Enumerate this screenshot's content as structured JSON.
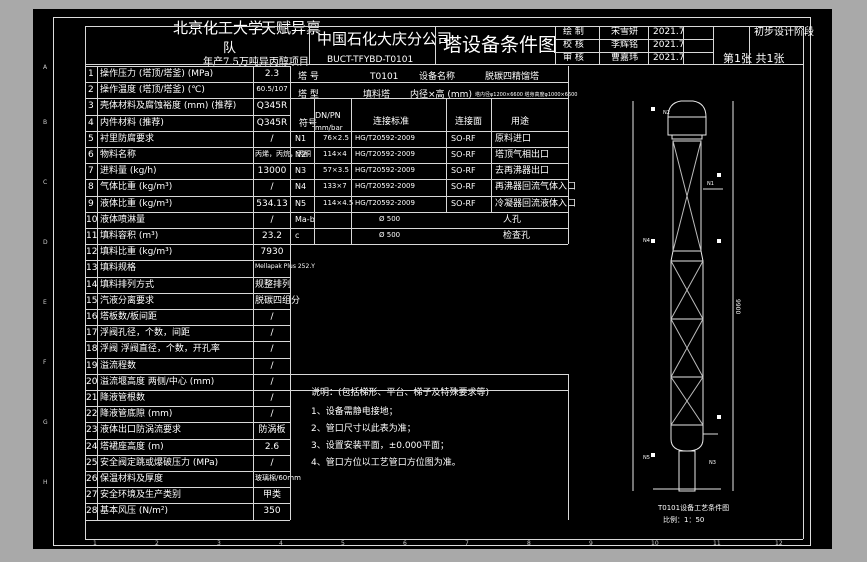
{
  "header": {
    "university": "北京化工大学",
    "team": "天赋异禀",
    "team2": "队",
    "project_line": "年产7.5万吨异丙醇项目",
    "company": "中国石化大庆分公司",
    "doc_no": "BUCT-TFYBD-T0101",
    "doc_title": "塔设备条件图",
    "sign_rows": [
      {
        "role": "绘 制",
        "name": "宋雪妍",
        "date": "2021.7"
      },
      {
        "role": "校 核",
        "name": "李辉铭",
        "date": "2021.7"
      },
      {
        "role": "审 核",
        "name": "曹嘉玮",
        "date": "2021.7"
      }
    ],
    "stage": "初步设计阶段",
    "sheet": "第1张  共1张"
  },
  "params": [
    {
      "no": "1",
      "name": "操作压力 (塔顶/塔釜) (MPa)",
      "value": "2.3"
    },
    {
      "no": "2",
      "name": "操作温度 (塔顶/塔釜) (℃)",
      "value": "60.5/107"
    },
    {
      "no": "3",
      "name": "壳体材料及腐蚀裕度 (mm) (推荐)",
      "value": "Q345R"
    },
    {
      "no": "4",
      "name": "内件材料 (推荐)",
      "value": "Q345R"
    },
    {
      "no": "5",
      "name": "衬里防腐要求",
      "value": "/"
    },
    {
      "no": "6",
      "name": "物料名称",
      "value": "丙烯，丙烷，丙酮"
    },
    {
      "no": "7",
      "name": "进料量 (kg/h)",
      "value": "13000"
    },
    {
      "no": "8",
      "name": "气体比重 (kg/m³)",
      "value": "/"
    },
    {
      "no": "9",
      "name": "液体比重 (kg/m³)",
      "value": "534.13"
    },
    {
      "no": "10",
      "name": "液体喷淋量",
      "value": "/"
    },
    {
      "no": "11",
      "name": "填料容积 (m³)",
      "value": "23.2"
    },
    {
      "no": "12",
      "name": "填料比重 (kg/m³)",
      "value": "7930"
    },
    {
      "no": "13",
      "name": "填料规格",
      "value": "Mellapak Plus 252.Y"
    },
    {
      "no": "14",
      "name": "填料排列方式",
      "value": "规整排列"
    },
    {
      "no": "15",
      "name": "汽液分离要求",
      "value": "脱碳四组分"
    },
    {
      "no": "16",
      "name": "塔板数/板间距",
      "value": "/"
    },
    {
      "no": "17",
      "name": "浮阀孔径，个数，间距",
      "value": "/"
    },
    {
      "no": "18",
      "name": "浮阀 浮阀直径，个数，开孔率",
      "value": "/"
    },
    {
      "no": "19",
      "name": "溢流程数",
      "value": "/"
    },
    {
      "no": "20",
      "name": "溢流堰高度 两侧/中心 (mm)",
      "value": "/"
    },
    {
      "no": "21",
      "name": "降液管根数",
      "value": "/"
    },
    {
      "no": "22",
      "name": "降液管底隙 (mm)",
      "value": "/"
    },
    {
      "no": "23",
      "name": "液体出口防涡流要求",
      "value": "防涡板"
    },
    {
      "no": "24",
      "name": "塔裙座高度 (m)",
      "value": "2.6"
    },
    {
      "no": "25",
      "name": "安全阀定跳或爆破压力 (MPa)",
      "value": "/"
    },
    {
      "no": "26",
      "name": "保温材料及厚度",
      "value": "玻璃棉/60mm"
    },
    {
      "no": "27",
      "name": "安全环境及生产类别",
      "value": "甲类"
    },
    {
      "no": "28",
      "name": "基本风压 (N/m²)",
      "value": "350"
    }
  ],
  "equipment": {
    "label_no": "塔 号",
    "no": "T0101",
    "label_name": "设备名称",
    "name": "脱碳四精馏塔",
    "label_type": "塔 型",
    "type": "填料塔",
    "label_dim": "内径×高 (mm)",
    "dim": "塔内径φ1200×6600  塔身高度φ1000×6600"
  },
  "nozzle_head": {
    "c1": "符号",
    "c2": "DN/PN",
    "c2b": "mm/bar",
    "c3": "连接标准",
    "c4": "连接面",
    "c5": "用途"
  },
  "nozzles": [
    {
      "sym": "N1",
      "dn": "76×2.5",
      "std": "HG/T20592-2009",
      "face": "SO-RF",
      "use": "原料进口"
    },
    {
      "sym": "N2",
      "dn": "114×4",
      "std": "HG/T20592-2009",
      "face": "SO-RF",
      "use": "塔顶气相出口"
    },
    {
      "sym": "N3",
      "dn": "57×3.5",
      "std": "HG/T20592-2009",
      "face": "SO-RF",
      "use": "去再沸器出口"
    },
    {
      "sym": "N4",
      "dn": "133×7",
      "std": "HG/T20592-2009",
      "face": "SO-RF",
      "use": "再沸器回流气体入口"
    },
    {
      "sym": "N5",
      "dn": "114×4.5",
      "std": "HG/T20592-2009",
      "face": "SO-RF",
      "use": "冷凝器回流液体入口"
    },
    {
      "sym": "Ma-b",
      "dn": "",
      "std": "Ø 500",
      "face": "",
      "use": "人孔"
    },
    {
      "sym": "c",
      "dn": "",
      "std": "Ø 500",
      "face": "",
      "use": "检查孔"
    }
  ],
  "notes": {
    "title": "说明：(包括梯形、平台、梯子及特殊要求等)",
    "items": [
      "1、设备需静电接地；",
      "2、管口尺寸以此表为准；",
      "3、设置安装平面，±0.000平面；",
      "4、管口方位以工艺管口方位图为准。"
    ]
  },
  "drawing": {
    "caption": "T0101设备工艺条件图",
    "scale": "比例：1：50",
    "height_label": "9900"
  },
  "border": {
    "top_nums": [
      "1",
      "2",
      "3",
      "4",
      "5",
      "6",
      "7",
      "8",
      "9",
      "10",
      "11",
      "12"
    ],
    "side_letters": [
      "A",
      "B",
      "C",
      "D",
      "E",
      "F",
      "G",
      "H"
    ]
  }
}
